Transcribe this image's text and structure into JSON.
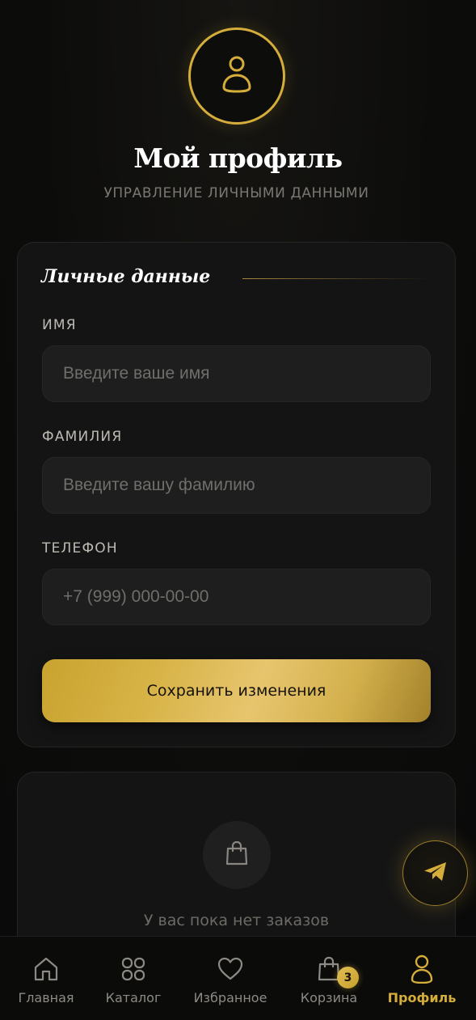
{
  "header": {
    "title": "Мой профиль",
    "subtitle": "УПРАВЛЕНИЕ ЛИЧНЫМИ ДАННЫМИ",
    "avatar_icon": "user-icon"
  },
  "personal": {
    "section_title": "Личные данные",
    "first_name": {
      "label": "ИМЯ",
      "value": "",
      "placeholder": "Введите ваше имя"
    },
    "last_name": {
      "label": "ФАМИЛИЯ",
      "value": "",
      "placeholder": "Введите вашу фамилию"
    },
    "phone": {
      "label": "ТЕЛЕФОН",
      "value": "",
      "placeholder": "+7 (999) 000-00-00"
    },
    "save_label": "Сохранить изменения"
  },
  "orders": {
    "icon": "shopping-bag-icon",
    "empty_text": "У вас пока нет заказов"
  },
  "telegram_button": {
    "icon": "paper-plane-icon"
  },
  "nav": {
    "items": [
      {
        "label": "Главная",
        "icon": "home-icon"
      },
      {
        "label": "Каталог",
        "icon": "grid-icon"
      },
      {
        "label": "Избранное",
        "icon": "heart-icon"
      },
      {
        "label": "Корзина",
        "icon": "shopping-bag-icon",
        "badge": "3"
      },
      {
        "label": "Профиль",
        "icon": "user-icon",
        "active": true
      }
    ]
  },
  "colors": {
    "accent": "#d4ad3a",
    "background": "#0c0c0b",
    "card": "#141414",
    "input": "#1e1e1e"
  }
}
